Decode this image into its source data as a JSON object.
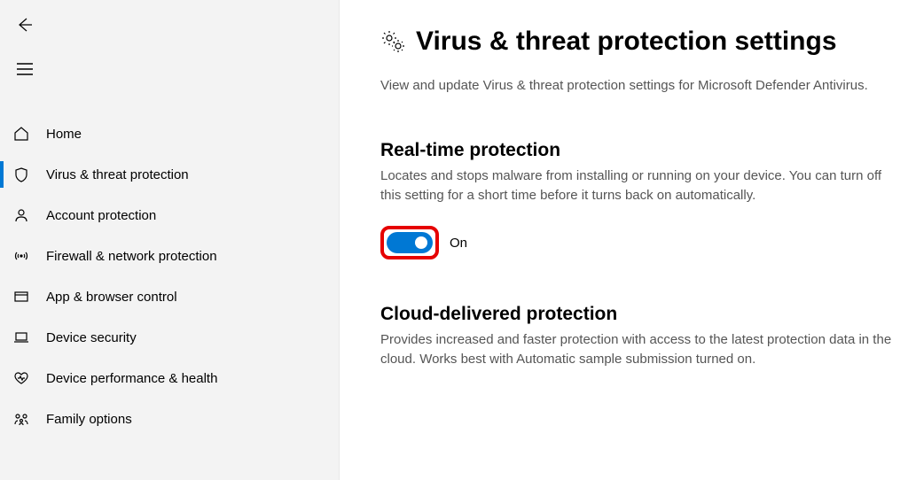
{
  "sidebar": {
    "items": [
      {
        "label": "Home"
      },
      {
        "label": "Virus & threat protection"
      },
      {
        "label": "Account protection"
      },
      {
        "label": "Firewall & network protection"
      },
      {
        "label": "App & browser control"
      },
      {
        "label": "Device security"
      },
      {
        "label": "Device performance & health"
      },
      {
        "label": "Family options"
      }
    ]
  },
  "page": {
    "title": "Virus & threat protection settings",
    "subtitle": "View and update Virus & threat protection settings for Microsoft Defender Antivirus."
  },
  "realtime": {
    "title": "Real-time protection",
    "desc": "Locates and stops malware from installing or running on your device. You can turn off this setting for a short time before it turns back on automatically.",
    "toggle_state": "On"
  },
  "cloud": {
    "title": "Cloud-delivered protection",
    "desc": "Provides increased and faster protection with access to the latest protection data in the cloud. Works best with Automatic sample submission turned on."
  }
}
